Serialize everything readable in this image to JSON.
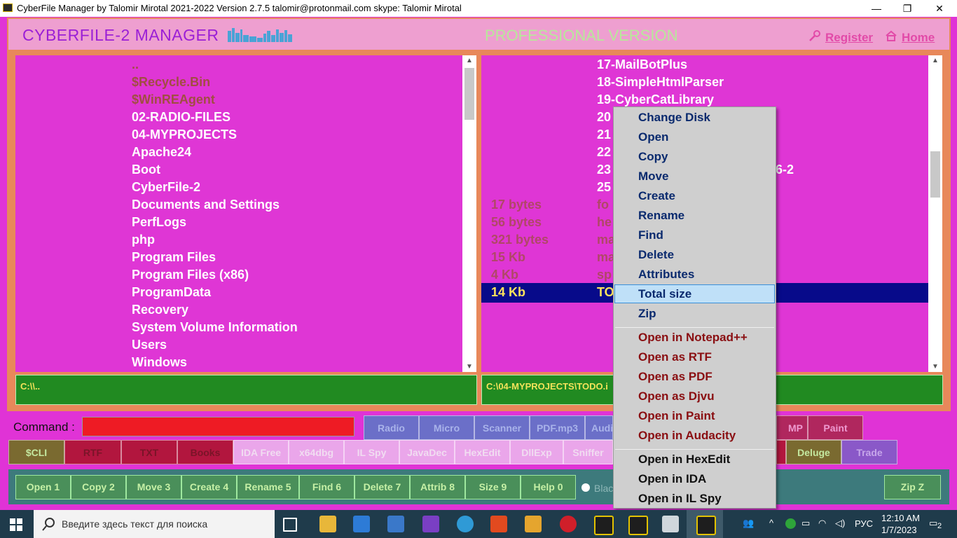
{
  "window": {
    "title": "CyberFile Manager by Talomir Mirotal 2021-2022 Version 2.7.5    talomir@protonmail.com    skype: Talomir Mirotal",
    "minimize": "—",
    "restore": "❐",
    "close": "✕"
  },
  "header": {
    "brand": "CYBERFILE-2 MANAGER",
    "edition": "PROFESSIONAL VERSION",
    "register": "Register",
    "home": "Home"
  },
  "left_panel": {
    "items": [
      {
        "name": "..",
        "kind": "sys"
      },
      {
        "name": "$Recycle.Bin",
        "kind": "sys"
      },
      {
        "name": "$WinREAgent",
        "kind": "sys"
      },
      {
        "name": "02-RADIO-FILES",
        "kind": "dir"
      },
      {
        "name": "04-MYPROJECTS",
        "kind": "dir"
      },
      {
        "name": "Apache24",
        "kind": "dir"
      },
      {
        "name": "Boot",
        "kind": "dir"
      },
      {
        "name": "CyberFile-2",
        "kind": "dir"
      },
      {
        "name": "Documents and Settings",
        "kind": "dir"
      },
      {
        "name": "PerfLogs",
        "kind": "dir"
      },
      {
        "name": "php",
        "kind": "dir"
      },
      {
        "name": "Program Files",
        "kind": "dir"
      },
      {
        "name": "Program Files (x86)",
        "kind": "dir"
      },
      {
        "name": "ProgramData",
        "kind": "dir"
      },
      {
        "name": "Recovery",
        "kind": "dir"
      },
      {
        "name": "System Volume Information",
        "kind": "dir"
      },
      {
        "name": "Users",
        "kind": "dir"
      },
      {
        "name": "Windows",
        "kind": "dir"
      }
    ],
    "path": "C:\\\\.."
  },
  "right_panel": {
    "dirs": [
      "17-MailBotPlus",
      "18-SimpleHtmlParser",
      "19-CyberCatLibrary",
      "20",
      "21",
      "22",
      "23",
      "25"
    ],
    "dir_tail_23": "6-2",
    "files": [
      {
        "size": "17  bytes",
        "name": "fo"
      },
      {
        "size": "56  bytes",
        "name": "he"
      },
      {
        "size": "321  bytes",
        "name": "ma"
      },
      {
        "size": "15  Kb",
        "name": "ma"
      },
      {
        "size": "4  Kb",
        "name": "sp"
      }
    ],
    "selected": {
      "size": "14  Kb",
      "name": "TO"
    },
    "path": "C:\\04-MYPROJECTS\\TODO.i"
  },
  "command": {
    "label": "Command :"
  },
  "tools_row1": [
    "Radio",
    "Micro",
    "Scanner",
    "PDF.mp3",
    "Audi",
    "MP",
    "Paint"
  ],
  "tools_row2": [
    "$CLI",
    "RTF",
    "TXT",
    "Books",
    "IDA Free",
    "x64dbg",
    "IL Spy",
    "JavaDec",
    "HexEdit",
    "DllExp",
    "Sniffer",
    "Deluge",
    "Trade"
  ],
  "function_keys": [
    "Open 1",
    "Copy 2",
    "Move 3",
    "Create 4",
    "Rename 5",
    "Find 6",
    "Delete 7",
    "Attrib 8",
    "Size 9",
    "Help 0"
  ],
  "radio_label": "Blac",
  "zip_button": "Zip Z",
  "context_menu": {
    "group1": [
      "Change Disk",
      "Open",
      "Copy",
      "Move",
      "Create",
      "Rename",
      "Find",
      "Delete",
      "Attributes",
      "Total size",
      "Zip"
    ],
    "highlighted": "Total size",
    "group2": [
      "Open in Notepad++",
      "Open as RTF",
      "Open as PDF",
      "Open as Djvu",
      "Open in Paint",
      "Open in Audacity"
    ],
    "group3": [
      "Open in HexEdit",
      "Open in IDA",
      "Open in IL Spy"
    ]
  },
  "taskbar": {
    "search_placeholder": "Введите здесь текст для поиска",
    "time": "12:10 AM",
    "date": "1/7/2023",
    "lang": "РУС",
    "notifications": "2"
  }
}
